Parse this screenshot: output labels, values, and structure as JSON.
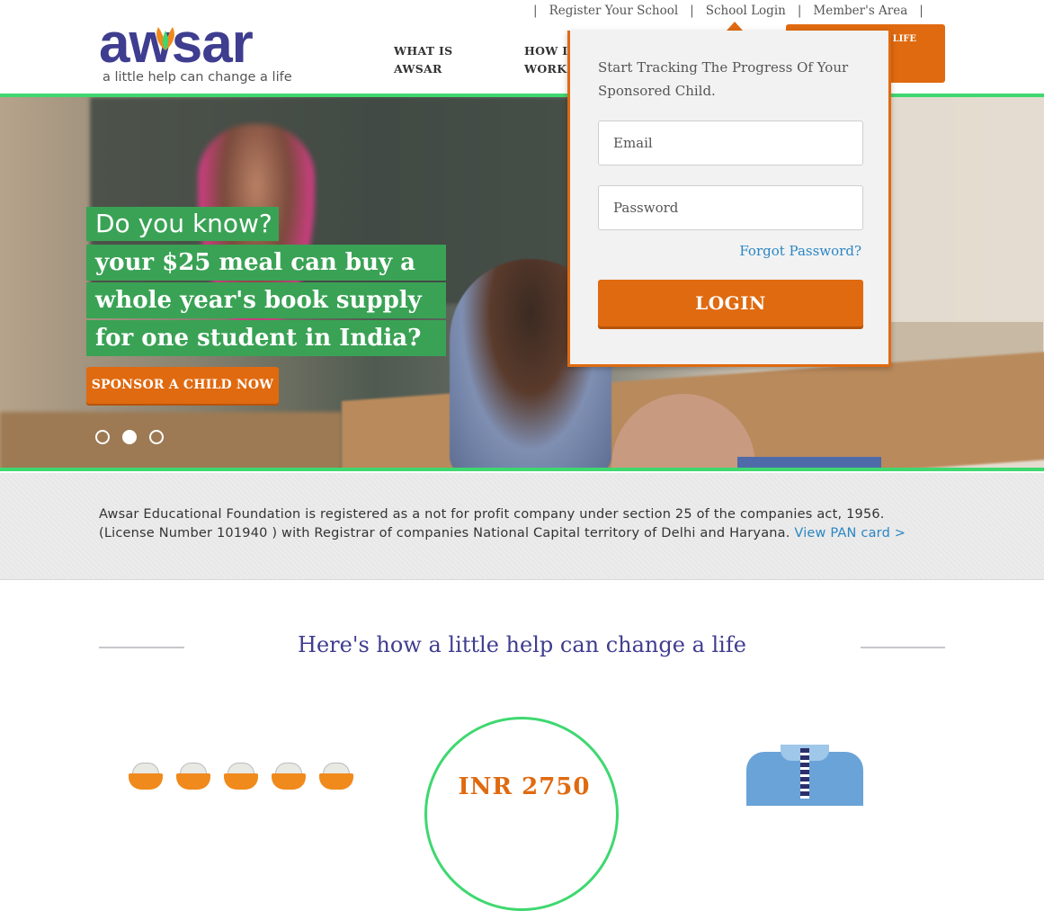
{
  "brand": {
    "logo_text": "awsar",
    "tagline": "a little help can change a life",
    "colors": {
      "purple": "#3f3d8f",
      "orange": "#e06a10",
      "green": "#3ed86f",
      "hl_green": "#3aa255",
      "link_blue": "#2a86c4"
    }
  },
  "top_links": {
    "sep": "|",
    "register": "Register Your School",
    "school_login": "School Login",
    "members": "Member's Area"
  },
  "nav": {
    "what_is_1": "WHAT IS",
    "what_is_2": "AWSAR",
    "how_it_1": "HOW IT",
    "how_it_2": "WORKS",
    "cta_partial": "A LIFE"
  },
  "hero": {
    "line1": "Do you know?",
    "line2": "your $25 meal can buy a",
    "line3": "whole year's book supply",
    "line4": "for one student in India?",
    "sponsor_button": "SPONSOR A CHILD NOW",
    "slide_count": 3,
    "active_slide": 2
  },
  "login": {
    "title": "Start Tracking The Progress Of Your Sponsored Child.",
    "email_placeholder": "Email",
    "password_placeholder": "Password",
    "forgot": "Forgot Password?",
    "button": "LOGIN"
  },
  "registration": {
    "text": "Awsar Educational Foundation is registered as a not for profit company under section 25 of the companies act, 1956. (License Number 101940 ) with Registrar of companies National Capital territory of Delhi and Haryana.",
    "link": "View PAN card >"
  },
  "section": {
    "title": "Here's how a little help can change a life",
    "circle_value": "INR 2750"
  },
  "icons": [
    "leaf-icon",
    "rice-bowl-icon",
    "uniform-icon"
  ]
}
